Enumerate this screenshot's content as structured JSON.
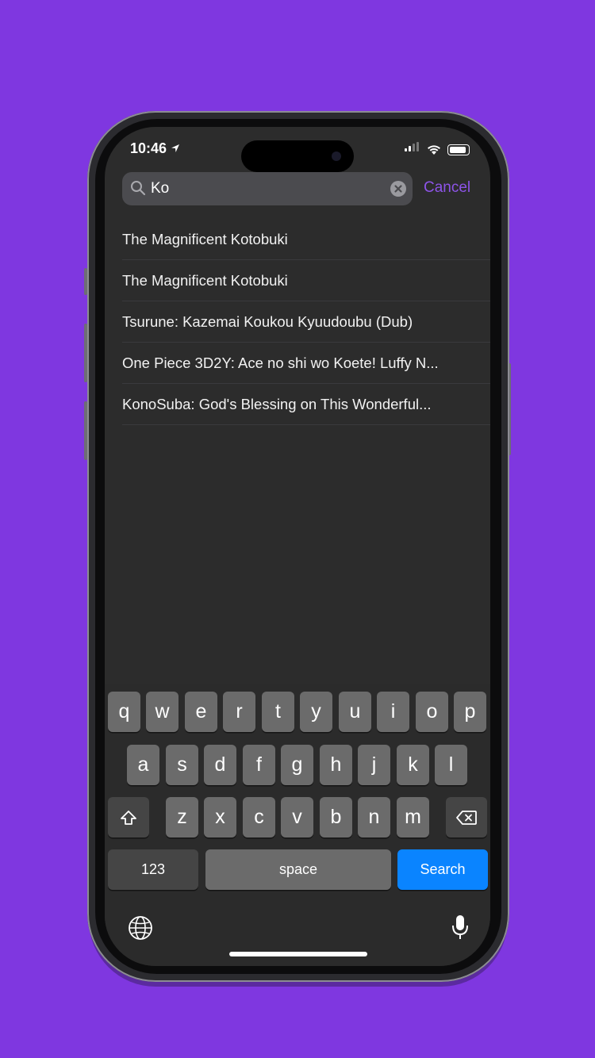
{
  "status_bar": {
    "time": "10:46",
    "location_arrow": "location-arrow-icon"
  },
  "search": {
    "value": "Ko",
    "icon": "search-icon",
    "clear_icon": "clear-icon",
    "cancel_label": "Cancel"
  },
  "results": [
    "The Magnificent Kotobuki",
    "The Magnificent Kotobuki",
    "Tsurune: Kazemai Koukou Kyuudoubu (Dub)",
    "One Piece 3D2Y: Ace no shi wo Koete! Luffy N...",
    "KonoSuba: God's Blessing on This Wonderful..."
  ],
  "keyboard": {
    "row1": [
      "q",
      "w",
      "e",
      "r",
      "t",
      "y",
      "u",
      "i",
      "o",
      "p"
    ],
    "row2": [
      "a",
      "s",
      "d",
      "f",
      "g",
      "h",
      "j",
      "k",
      "l"
    ],
    "row3": [
      "z",
      "x",
      "c",
      "v",
      "b",
      "n",
      "m"
    ],
    "numbers_label": "123",
    "space_label": "space",
    "search_label": "Search"
  },
  "colors": {
    "background": "#7f37e0",
    "accent": "#8d54e8",
    "search_key": "#0a84ff"
  }
}
